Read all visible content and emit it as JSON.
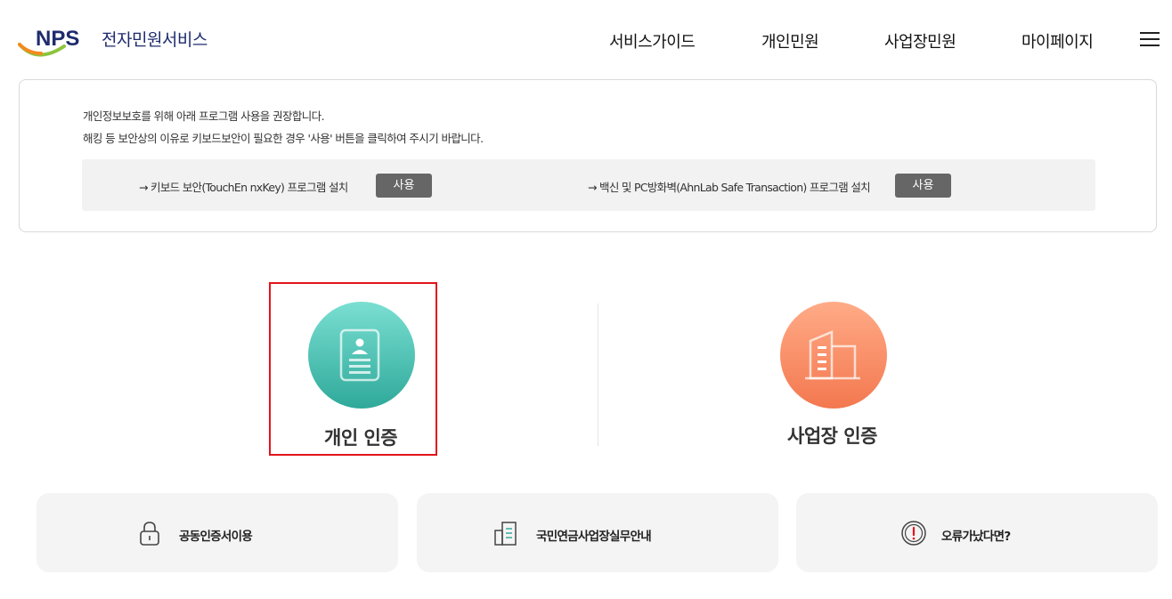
{
  "header": {
    "logo_mark": "NPS",
    "logo_text": "전자민원서비스",
    "nav": [
      "서비스가이드",
      "개인민원",
      "사업장민원",
      "마이페이지"
    ],
    "menu_icon": "hamburger-icon"
  },
  "notice": {
    "line1": "개인정보보호를 위해 아래 프로그램 사용을 권장합니다.",
    "line2": "해킹 등 보안상의 이유로 키보드보안이 필요한 경우 '사용' 버튼을 클릭하여 주시기 바랍니다.",
    "items": [
      {
        "label": "→ 키보드 보안(TouchEn nxKey) 프로그램 설치",
        "button": "사용"
      },
      {
        "label": "→ 백신 및 PC방화벽(AhnLab Safe Transaction) 프로그램 설치",
        "button": "사용"
      }
    ]
  },
  "auth": {
    "personal": {
      "label": "개인 인증",
      "icon": "id-card-icon"
    },
    "business": {
      "label": "사업장 인증",
      "icon": "building-icon"
    }
  },
  "cards": [
    {
      "label": "공동인증서이용",
      "icon": "lock-icon"
    },
    {
      "label": "국민연금사업장실무안내",
      "icon": "office-document-icon"
    },
    {
      "label": "오류가났다면?",
      "icon": "alert-circle-icon"
    }
  ],
  "colors": {
    "brand_navy": "#1e2b6d",
    "personal_gradient": [
      "#7adfd2",
      "#2fa99a"
    ],
    "business_gradient": [
      "#ffab87",
      "#f3784f"
    ],
    "highlight_border": "#e2141b"
  }
}
